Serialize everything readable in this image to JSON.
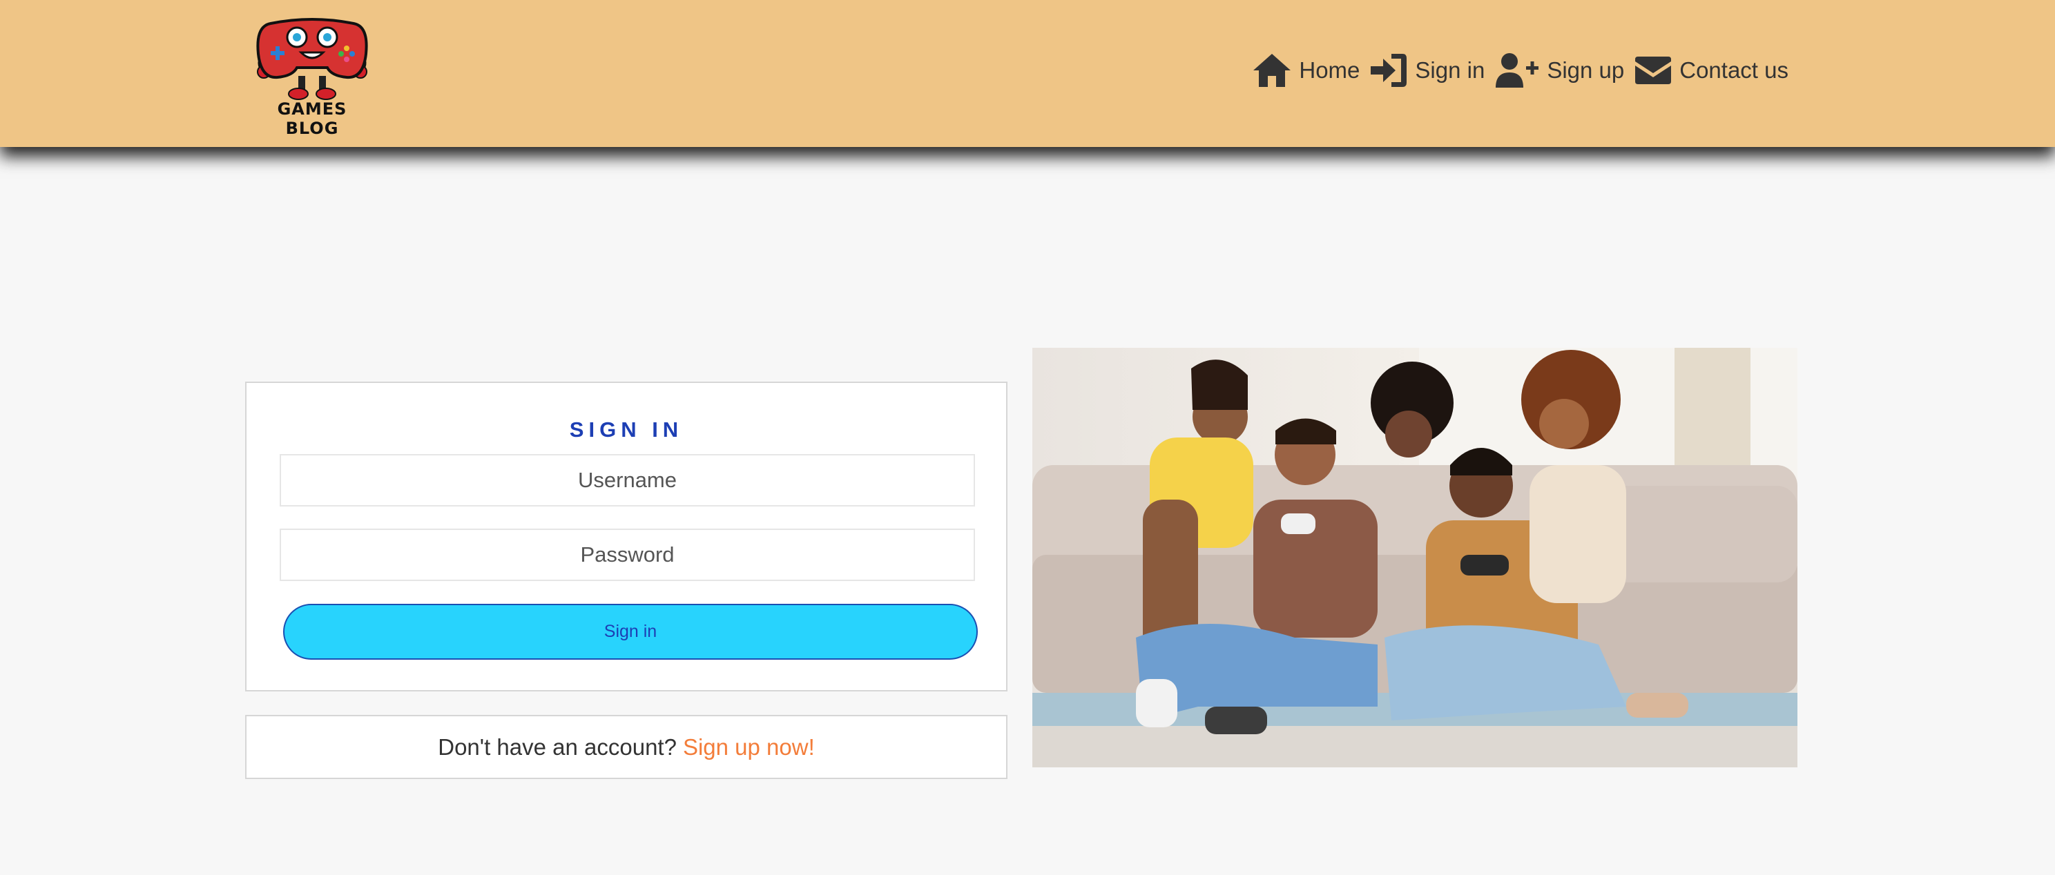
{
  "header": {
    "logo_text": "GAMES BLOG",
    "nav": [
      {
        "label": "Home",
        "icon": "home-icon"
      },
      {
        "label": "Sign in",
        "icon": "sign-in-icon"
      },
      {
        "label": "Sign up",
        "icon": "user-plus-icon"
      },
      {
        "label": "Contact us",
        "icon": "envelope-icon"
      }
    ]
  },
  "signin": {
    "title": "SIGN IN",
    "username_placeholder": "Username",
    "password_placeholder": "Password",
    "button_label": "Sign in"
  },
  "signup": {
    "prompt": "Don't have an account?",
    "link": "Sign up now!"
  },
  "colors": {
    "header_bg": "#efc586",
    "page_bg": "#f7f7f7",
    "title_blue": "#1d3fb4",
    "button_cyan": "#28d3fd",
    "link_orange": "#f37d3a"
  }
}
